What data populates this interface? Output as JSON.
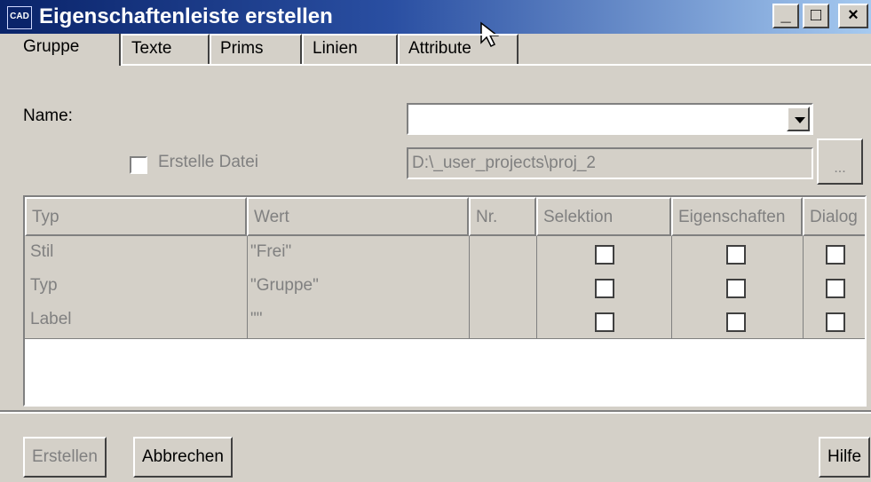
{
  "window": {
    "app_icon_text": "CAD",
    "title": "Eigenschaftenleiste erstellen",
    "minimize": "_",
    "maximize": "□",
    "close": "×"
  },
  "tabs": [
    "Gruppe",
    "Texte",
    "Prims",
    "Linien",
    "Attribute"
  ],
  "name_row": {
    "label": "Name:",
    "value": ""
  },
  "file_row": {
    "checkbox_label": "Erstelle Datei",
    "checked": false,
    "path": "D:\\_user_projects\\proj_2",
    "browse_label": "..."
  },
  "table": {
    "columns": [
      "Typ",
      "Wert",
      "Nr.",
      "Selektion",
      "Eigenschaften",
      "Dialog"
    ],
    "rows": [
      {
        "typ": "Stil",
        "wert": "\"Frei\"",
        "nr": "",
        "selektion": false,
        "eigenschaften": false,
        "dialog": false
      },
      {
        "typ": "Typ",
        "wert": "\"Gruppe\"",
        "nr": "",
        "selektion": false,
        "eigenschaften": false,
        "dialog": false
      },
      {
        "typ": "Label",
        "wert": "\"\"",
        "nr": "",
        "selektion": false,
        "eigenschaften": false,
        "dialog": false
      }
    ]
  },
  "buttons": {
    "create": "Erstellen",
    "cancel": "Abbrechen",
    "help": "Hilfe"
  }
}
